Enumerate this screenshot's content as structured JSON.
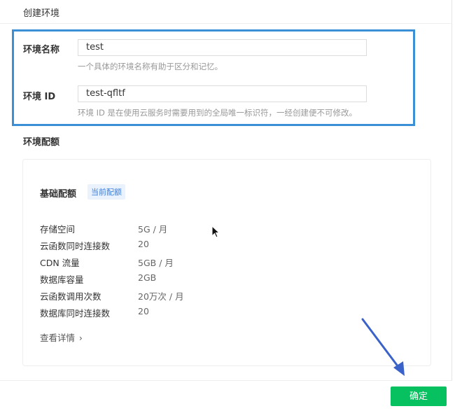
{
  "dialog": {
    "title": "创建环境"
  },
  "env_name": {
    "label": "环境名称",
    "value": "test",
    "hint": "一个具体的环境名称有助于区分和记忆。"
  },
  "env_id": {
    "label": "环境 ID",
    "value": "test-qfltf",
    "hint": "环境 ID 是在使用云服务时需要用到的全局唯一标识符，一经创建便不可修改。"
  },
  "quota_section": {
    "title": "环境配额",
    "card_title": "基础配额",
    "badge": "当前配额",
    "rows": [
      {
        "name": "存储空间",
        "value": "5G / 月"
      },
      {
        "name": "云函数同时连接数",
        "value": "20"
      },
      {
        "name": "CDN 流量",
        "value": "5GB / 月"
      },
      {
        "name": "数据库容量",
        "value": "2GB"
      },
      {
        "name": "云函数调用次数",
        "value": "20万次 / 月"
      },
      {
        "name": "数据库同时连接数",
        "value": "20"
      }
    ],
    "details_link": "查看详情",
    "details_chevron": "›"
  },
  "footer": {
    "confirm_label": "确定"
  },
  "colors": {
    "accent_green": "#07c160",
    "highlight_blue": "#3b8fd6",
    "badge_blue": "#3d7ed8"
  },
  "icons": {
    "cursor": "mouse-pointer-icon",
    "annotation_arrow": "arrow-icon"
  }
}
